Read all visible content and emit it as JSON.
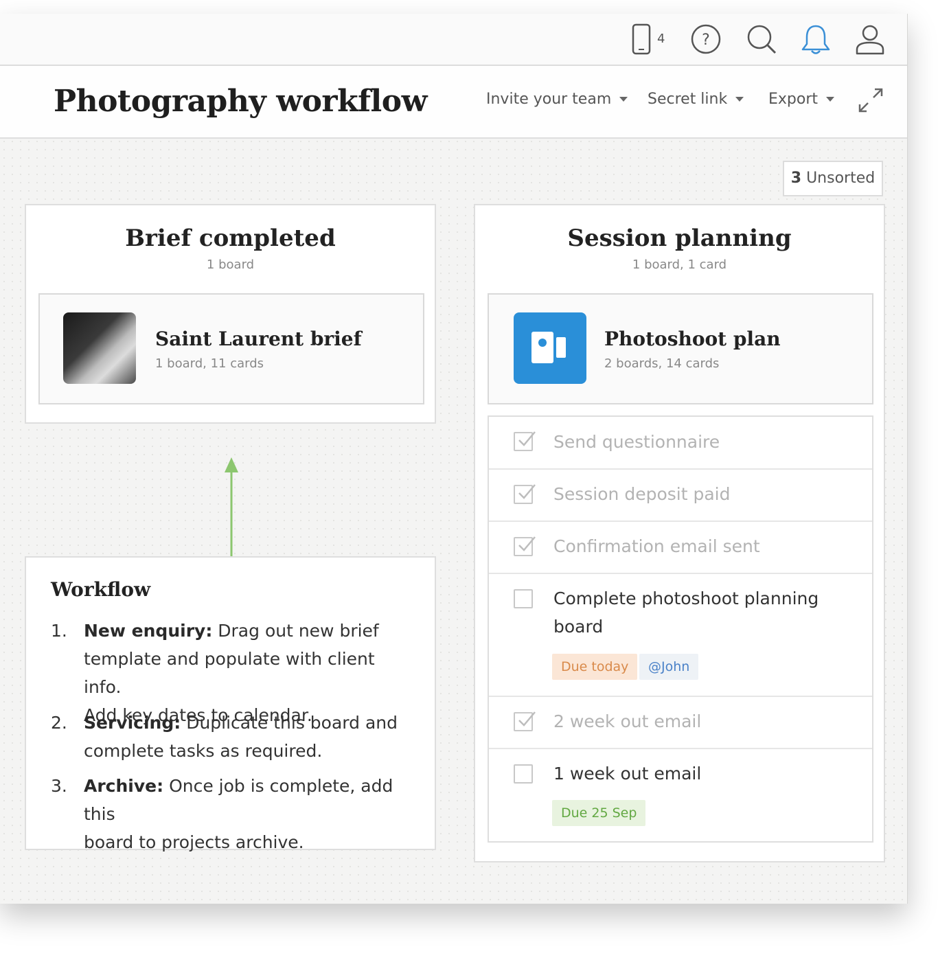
{
  "topbar": {
    "device_count": "4",
    "icons": [
      "phone-icon",
      "help-icon",
      "search-icon",
      "bell-icon",
      "user-icon"
    ],
    "bell_color": "#3a8fd6"
  },
  "header": {
    "title": "Photography workflow",
    "menus": [
      {
        "label": "Invite your team"
      },
      {
        "label": "Secret link"
      },
      {
        "label": "Export"
      }
    ]
  },
  "unsorted": {
    "count": "3",
    "label": "Unsorted"
  },
  "columns": [
    {
      "title": "Brief completed",
      "subtitle": "1 board",
      "board": {
        "title": "Saint Laurent brief",
        "subtitle": "1 board, 11 cards",
        "icon": "photo-thumbnail"
      }
    },
    {
      "title": "Session planning",
      "subtitle": "1 board, 1 card",
      "board": {
        "title": "Photoshoot plan",
        "subtitle": "2 boards, 14 cards",
        "icon": "board-icon",
        "color": "#2a8fd8"
      },
      "tasks": [
        {
          "text": "Send questionnaire",
          "checked": true
        },
        {
          "text": "Session deposit paid",
          "checked": true
        },
        {
          "text": "Confirmation email sent",
          "checked": true
        },
        {
          "text_line1": "Complete photoshoot planning",
          "text_line2": "board",
          "checked": false,
          "due": "Due today",
          "mention": "@John"
        },
        {
          "text": "2 week out email",
          "checked": true
        },
        {
          "text": "1 week out email",
          "checked": false,
          "due": "Due 25 Sep"
        }
      ]
    }
  ],
  "workflow": {
    "title": "Workflow",
    "steps": [
      {
        "num": "1.",
        "bold": "New enquiry:",
        "line1": " Drag out new brief",
        "line2": "template and populate with client info.",
        "line3": "Add key dates to calendar."
      },
      {
        "num": "2.",
        "bold": "Servicing:",
        "line1": " Duplicate this board and",
        "line2": "complete tasks as required."
      },
      {
        "num": "3.",
        "bold": "Archive:",
        "line1": " Once job is complete, add this",
        "line2": "board to projects archive."
      }
    ]
  },
  "colors": {
    "arrow": "#8cc66f",
    "due_today": "#d98a4a",
    "due_date": "#62a842",
    "mention": "#4b82c8"
  }
}
